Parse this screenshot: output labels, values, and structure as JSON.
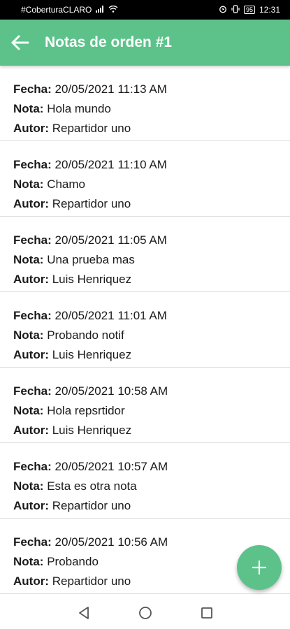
{
  "statusbar": {
    "carrier": "#CoberturaCLARO",
    "battery": "95",
    "time": "12:31"
  },
  "appbar": {
    "title": "Notas de orden #1",
    "back_icon": "arrow-left-icon"
  },
  "labels": {
    "fecha": "Fecha:",
    "nota": "Nota:",
    "autor": "Autor:"
  },
  "notes": [
    {
      "fecha": "20/05/2021 11:13 AM",
      "nota": "Hola mundo",
      "autor": "Repartidor uno"
    },
    {
      "fecha": "20/05/2021 11:10 AM",
      "nota": "Chamo",
      "autor": "Repartidor uno"
    },
    {
      "fecha": "20/05/2021 11:05 AM",
      "nota": "Una prueba mas",
      "autor": "Luis Henriquez"
    },
    {
      "fecha": "20/05/2021 11:01 AM",
      "nota": "Probando notif",
      "autor": "Luis Henriquez"
    },
    {
      "fecha": "20/05/2021 10:58 AM",
      "nota": "Hola repsrtidor",
      "autor": "Luis Henriquez"
    },
    {
      "fecha": "20/05/2021 10:57 AM",
      "nota": "Esta es otra nota",
      "autor": "Repartidor uno"
    },
    {
      "fecha": "20/05/2021 10:56 AM",
      "nota": "Probando",
      "autor": "Repartidor uno"
    }
  ],
  "fab": {
    "icon": "plus-icon"
  },
  "colors": {
    "accent": "#5cc28a",
    "statusbar": "#000000",
    "divider": "#dddddd"
  }
}
